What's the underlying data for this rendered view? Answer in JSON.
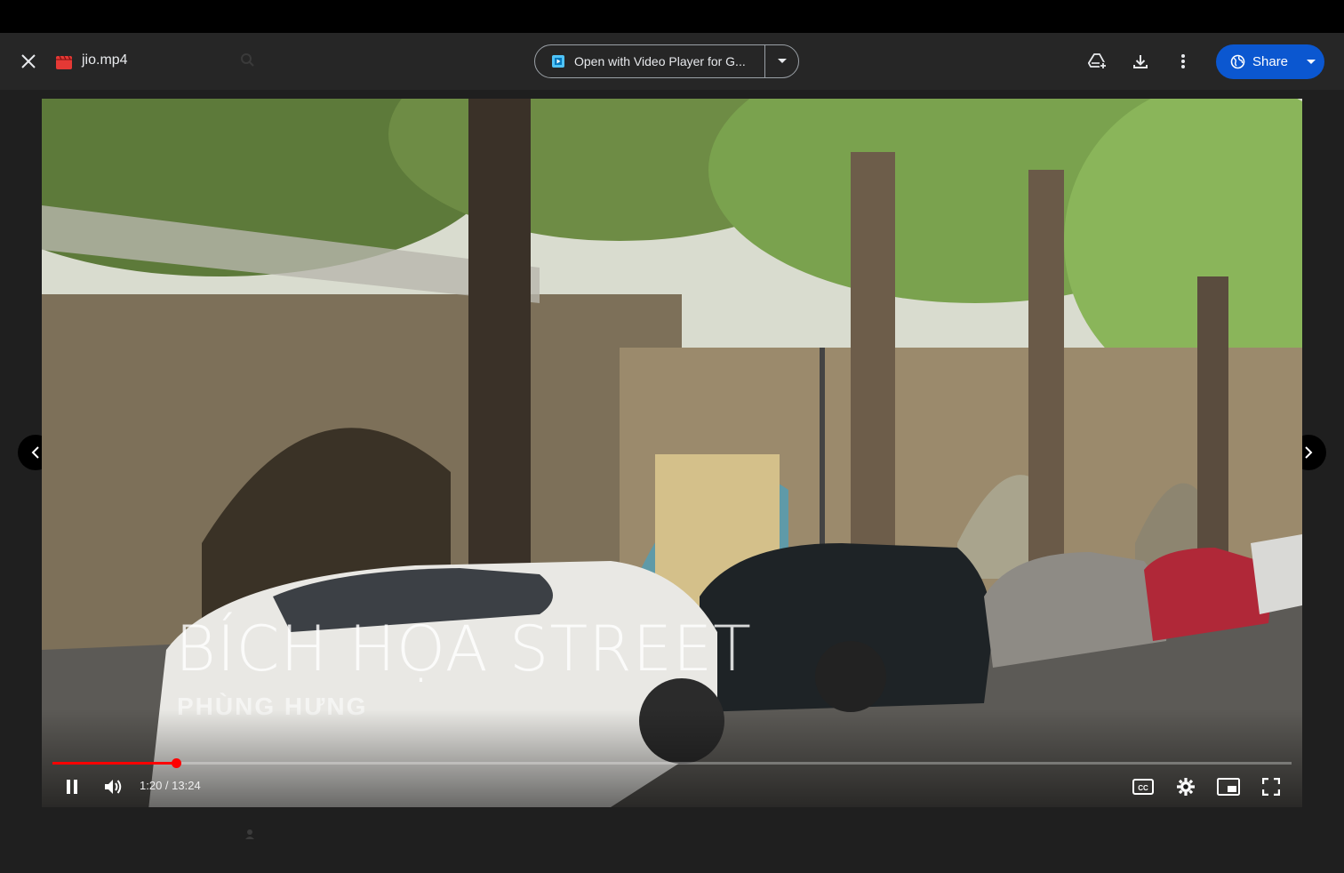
{
  "header": {
    "file_name": "jio.mp4",
    "open_with_label": "Open with Video Player for G...",
    "share_label": "Share"
  },
  "video": {
    "title_overlay": "BÍCH HỌA STREET",
    "subtitle_overlay": "PHÙNG HƯNG",
    "time": "1:20 / 13:24",
    "progress": 0.0995
  },
  "icons": {
    "close": "close-icon",
    "file": "video-file-icon",
    "open_with_app": "video-player-app-icon",
    "add_to_drive": "add-to-drive-icon",
    "download": "download-icon",
    "more": "more-vert-icon",
    "share": "globe-icon",
    "play_pause": "pause-icon",
    "volume": "volume-icon",
    "captions": "cc-icon",
    "settings": "gear-icon",
    "miniplayer": "miniplayer-icon",
    "fullscreen": "fullscreen-icon",
    "prev": "chevron-left-icon",
    "next": "chevron-right-icon"
  },
  "colors": {
    "accent": "#0b57d0",
    "progress": "#ff0000",
    "file_icon": "#e53935"
  }
}
